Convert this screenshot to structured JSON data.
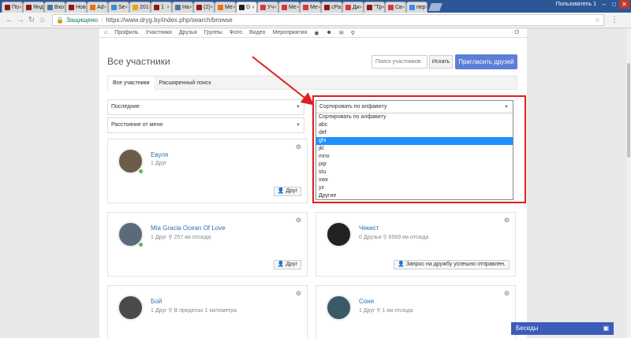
{
  "browser": {
    "tabs": [
      {
        "label": "По",
        "color": "#8b1a1a"
      },
      {
        "label": "Янд",
        "color": "#8b1a1a"
      },
      {
        "label": "Вхо",
        "color": "#4a76a8"
      },
      {
        "label": "Нов",
        "color": "#8b1a1a"
      },
      {
        "label": "Ad",
        "color": "#e8711a"
      },
      {
        "label": "Se",
        "color": "#3b8bd6"
      },
      {
        "label": "201",
        "color": "#e8a21a"
      },
      {
        "label": "1",
        "color": "#8b1a1a"
      },
      {
        "label": "На",
        "color": "#4a76a8"
      },
      {
        "label": "(2)",
        "color": "#8b1a1a"
      },
      {
        "label": "Ме",
        "color": "#e8711a"
      },
      {
        "label": "D",
        "color": "#222222"
      },
      {
        "label": "Уч",
        "color": "#d63b3b"
      },
      {
        "label": "Ме",
        "color": "#d63b3b"
      },
      {
        "label": "Ме",
        "color": "#d63b3b"
      },
      {
        "label": "cPa",
        "color": "#8b1a1a"
      },
      {
        "label": "Ди",
        "color": "#d63b3b"
      },
      {
        "label": "\"Тр",
        "color": "#8b1a1a"
      },
      {
        "label": "Св",
        "color": "#d63b3b"
      },
      {
        "label": "пер",
        "color": "#4285f4"
      }
    ],
    "user_label": "Пользователь 1",
    "secure_label": "Защищено",
    "url": "https://www.dryg.by/index.php/search/browse"
  },
  "nav": {
    "items": [
      "Профиль",
      "Участники",
      "Друзья",
      "Группы",
      "Фото",
      "Видео",
      "Мероприятия"
    ]
  },
  "page": {
    "title": "Все участники",
    "search_placeholder": "Поиск участников",
    "search_button": "Искать",
    "invite_button": "Пригласить друзей",
    "tabs": [
      "Все участники",
      "Расширенный поиск"
    ],
    "filter_recent": "Последние",
    "filter_distance": "Расстояние от меня",
    "sort_selected": "Сортировать по алфавиту"
  },
  "dropdown": {
    "options": [
      "Сортировать по алфавиту",
      "abc",
      "def",
      "ghi",
      "jkl",
      "mno",
      "pqr",
      "stu",
      "vwx",
      "yz",
      "Другие"
    ],
    "highlighted_index": 3
  },
  "cards": [
    {
      "name": "Евуля",
      "meta": "1 Друг",
      "button": "Друг",
      "avatar_color": "#6b5d4a",
      "online": true
    },
    {
      "name": "Mia Gracia Ocean Of Love",
      "meta": "1 Друг   ⚲ 257 км отсюда",
      "button": "Друг",
      "avatar_color": "#5a6a7a",
      "online": true
    },
    {
      "name": "Чекист",
      "meta": "0 Друзья   ⚲ 6569 км отсюда",
      "button": "Запрос на дружбу успешно отправлен.",
      "avatar_color": "#222222",
      "online": false
    },
    {
      "name": "Бой",
      "meta": "1 Друг   ⚲ В пределах 1 километра",
      "button": "",
      "avatar_color": "#4a4a4a",
      "online": false
    },
    {
      "name": "Соня",
      "meta": "1 Друг   ⚲ 1 км отсюда",
      "button": "",
      "avatar_color": "#3a5a6a",
      "online": false
    }
  ],
  "chat": {
    "label": "Беседы"
  },
  "colors": {
    "accent": "#5b7fd6",
    "highlight": "#1e90ff",
    "annotation": "#e01e1e"
  }
}
